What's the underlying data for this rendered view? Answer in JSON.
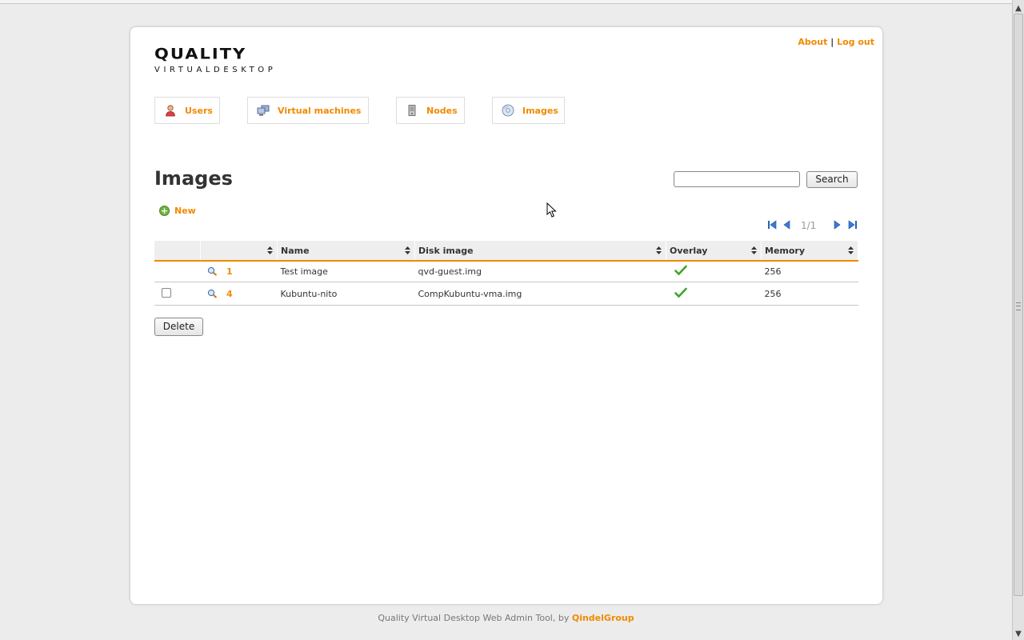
{
  "header": {
    "logo_main": "QUALITY",
    "logo_sub": "VIRTUALDESKTOP",
    "about": "About",
    "separator": "|",
    "logout": "Log out"
  },
  "nav": {
    "users": "Users",
    "virtual_machines": "Virtual machines",
    "nodes": "Nodes",
    "images": "Images"
  },
  "page": {
    "title": "Images",
    "search_button": "Search",
    "search_value": "",
    "new_label": "New",
    "pager_text": "1/1",
    "delete_button": "Delete"
  },
  "table": {
    "columns": [
      "",
      "",
      "Name",
      "Disk image",
      "Overlay",
      "Memory"
    ],
    "rows": [
      {
        "id": "1",
        "name": "Test image",
        "disk_image": "qvd-guest.img",
        "overlay": true,
        "memory": "256",
        "checkbox": false
      },
      {
        "id": "4",
        "name": "Kubuntu-nito",
        "disk_image": "CompKubuntu-vma.img",
        "overlay": true,
        "memory": "256",
        "checkbox": true
      }
    ]
  },
  "footer": {
    "text": "Quality Virtual Desktop Web Admin Tool, by",
    "link": "QindelGroup"
  },
  "colors": {
    "accent": "#f08a00",
    "background": "#ececec",
    "panel": "#ffffff",
    "check": "#3fa52a"
  }
}
